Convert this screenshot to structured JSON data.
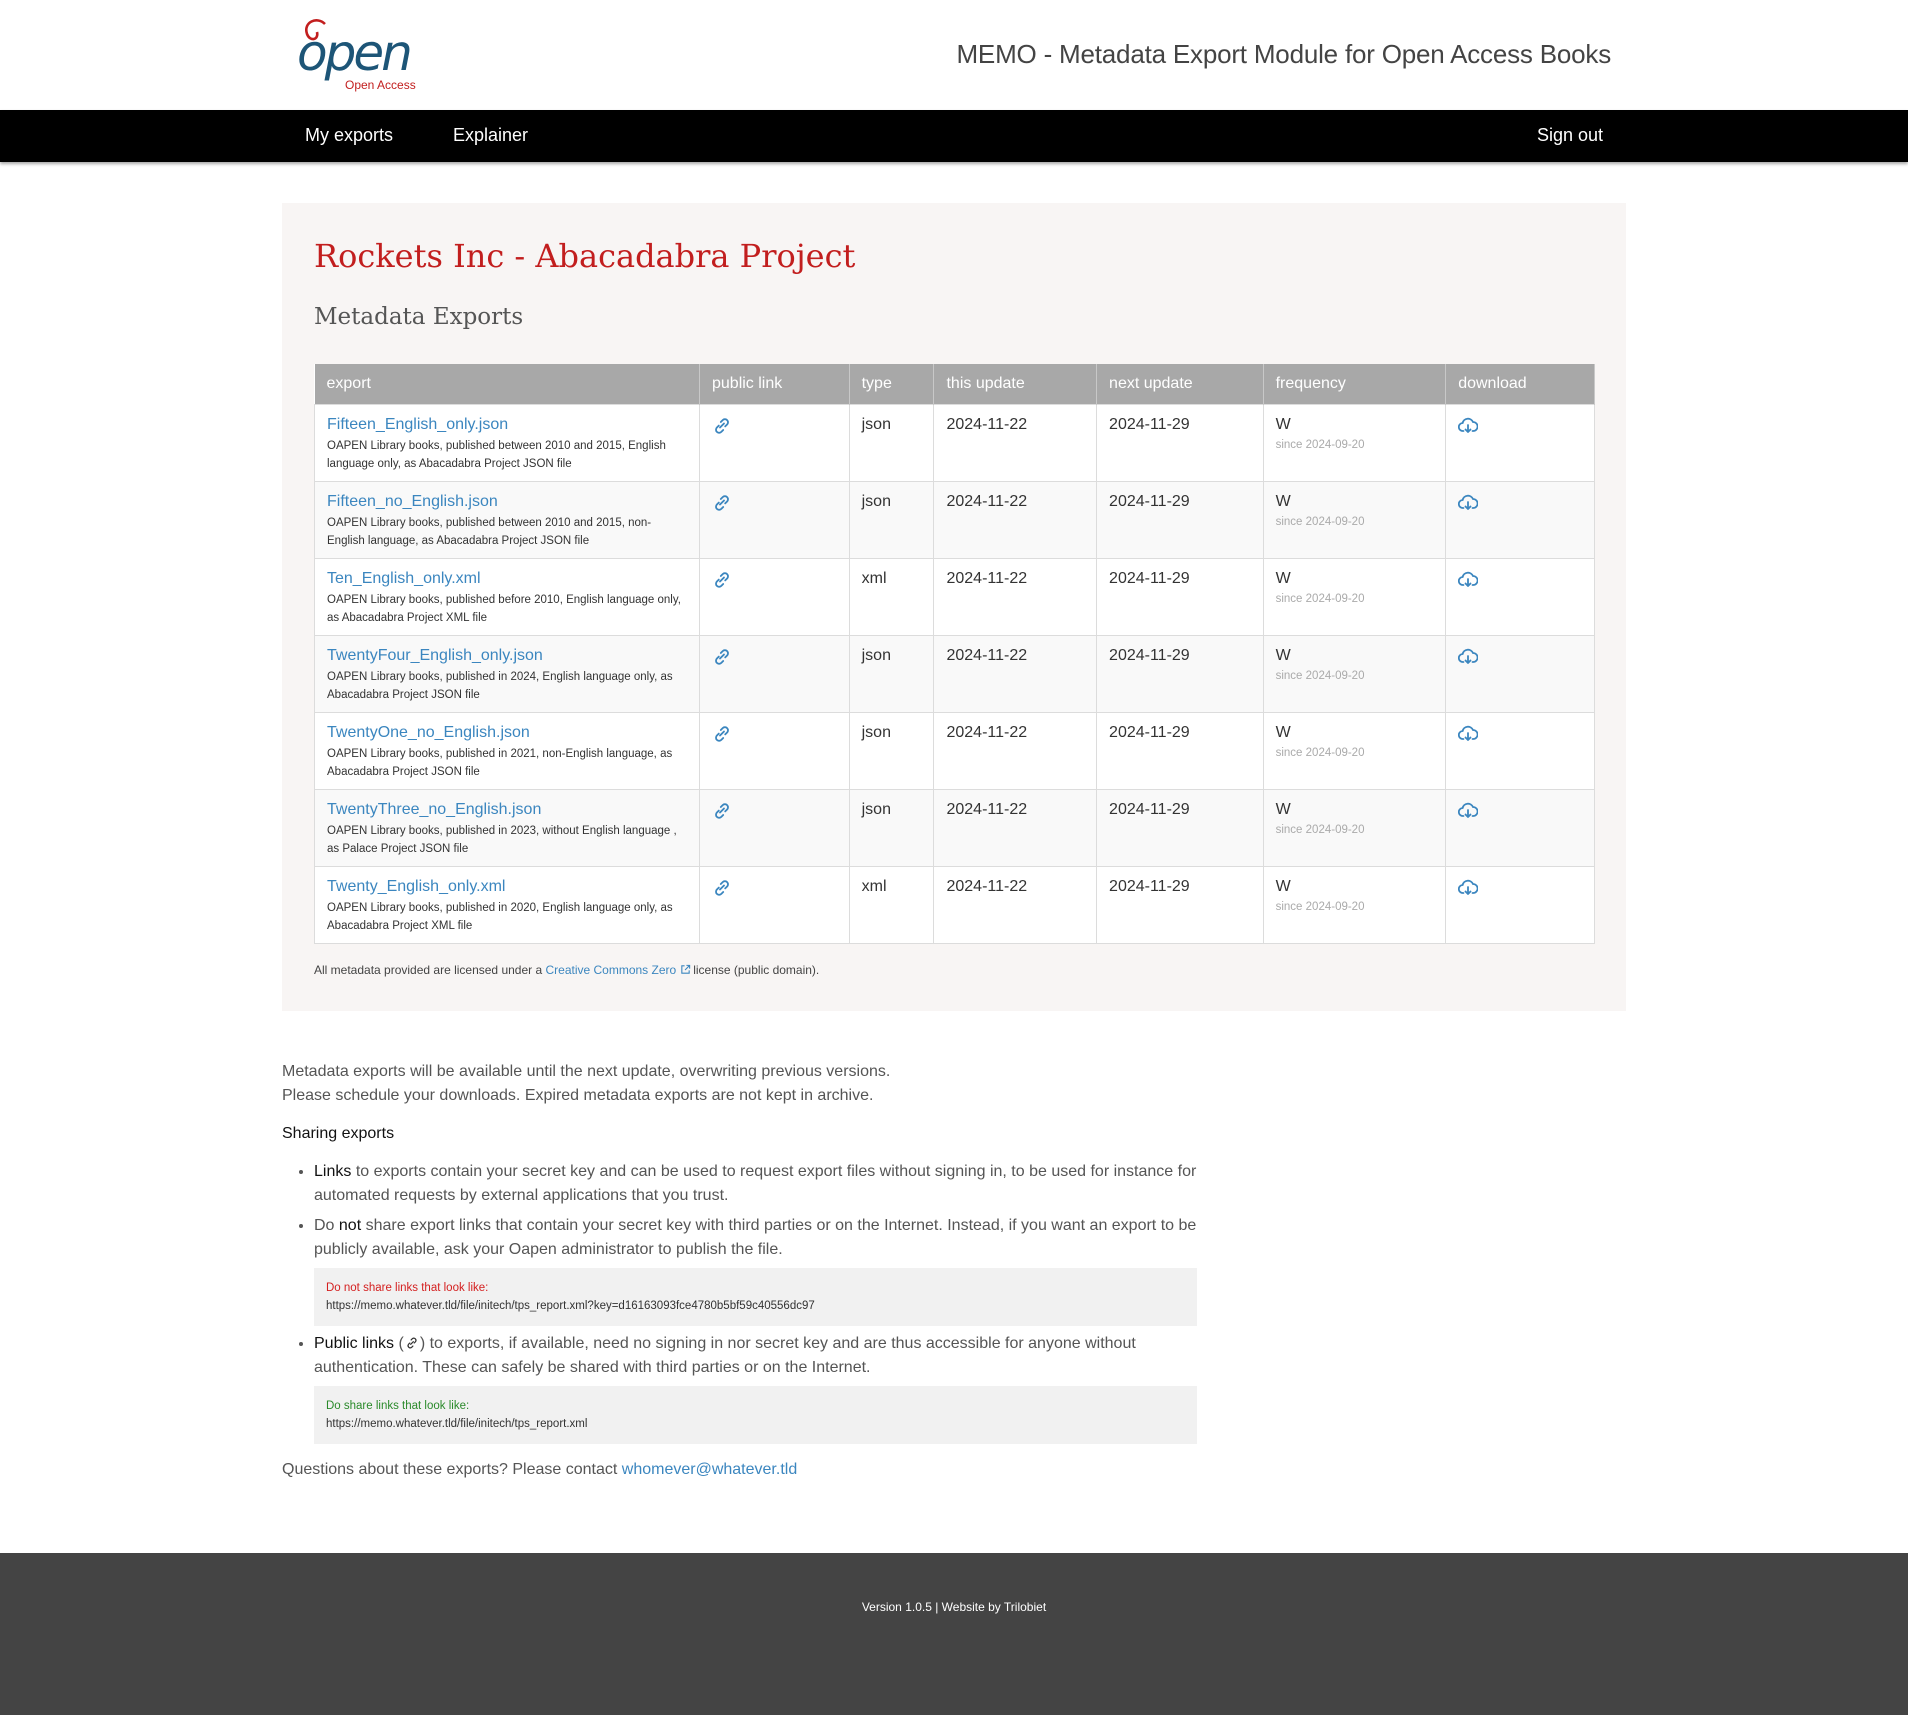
{
  "header": {
    "logo_text": "open",
    "logo_subtext": "Open Access",
    "site_title": "MEMO - Metadata Export Module for Open Access Books"
  },
  "nav": {
    "my_exports": "My exports",
    "explainer": "Explainer",
    "sign_out": "Sign out"
  },
  "panel": {
    "title": "Rockets Inc - Abacadabra Project",
    "subtitle": "Metadata Exports",
    "columns": [
      "export",
      "public link",
      "type",
      "this update",
      "next update",
      "frequency",
      "download"
    ],
    "rows": [
      {
        "name": "Fifteen_English_only.json",
        "desc": "OAPEN Library books, published between 2010 and 2015, English language only, as Abacadabra Project JSON file",
        "type": "json",
        "this_update": "2024-11-22",
        "next_update": "2024-11-29",
        "frequency": "W",
        "since": "since 2024-09-20"
      },
      {
        "name": "Fifteen_no_English.json",
        "desc": "OAPEN Library books, published between 2010 and 2015, non-English language, as Abacadabra Project JSON file",
        "type": "json",
        "this_update": "2024-11-22",
        "next_update": "2024-11-29",
        "frequency": "W",
        "since": "since 2024-09-20"
      },
      {
        "name": "Ten_English_only.xml",
        "desc": "OAPEN Library books, published before 2010, English language only, as Abacadabra Project XML file",
        "type": "xml",
        "this_update": "2024-11-22",
        "next_update": "2024-11-29",
        "frequency": "W",
        "since": "since 2024-09-20"
      },
      {
        "name": "TwentyFour_English_only.json",
        "desc": "OAPEN Library books, published in 2024, English language only, as Abacadabra Project JSON file",
        "type": "json",
        "this_update": "2024-11-22",
        "next_update": "2024-11-29",
        "frequency": "W",
        "since": "since 2024-09-20"
      },
      {
        "name": "TwentyOne_no_English.json",
        "desc": "OAPEN Library books, published in 2021, non-English language, as Abacadabra Project JSON file",
        "type": "json",
        "this_update": "2024-11-22",
        "next_update": "2024-11-29",
        "frequency": "W",
        "since": "since 2024-09-20"
      },
      {
        "name": "TwentyThree_no_English.json",
        "desc": "OAPEN Library books, published in 2023, without English language , as Palace Project JSON file",
        "type": "json",
        "this_update": "2024-11-22",
        "next_update": "2024-11-29",
        "frequency": "W",
        "since": "since 2024-09-20"
      },
      {
        "name": "Twenty_English_only.xml",
        "desc": "OAPEN Library books, published in 2020, English language only, as Abacadabra Project XML file",
        "type": "xml",
        "this_update": "2024-11-22",
        "next_update": "2024-11-29",
        "frequency": "W",
        "since": "since 2024-09-20"
      }
    ],
    "license_prefix": "All metadata provided are licensed under a",
    "license_link": "Creative Commons Zero",
    "license_suffix": "license (public domain)."
  },
  "info": {
    "line1": "Metadata exports will be available until the next update, overwriting previous versions.",
    "line2": "Please schedule your downloads. Expired metadata exports are not kept in archive.",
    "sharing_heading": "Sharing exports",
    "b1_strong": "Links",
    "b1_text": "to exports contain your secret key and can be used to request export files without signing in, to be used for instance for automated requests by external applications that you trust.",
    "b2_pre": "Do",
    "b2_strong": "not",
    "b2_text": "share export links that contain your secret key with third parties or on the Internet. Instead, if you want an export to be publicly available, ask your Oapen administrator to publish the file.",
    "warn_label": "Do not share links that look like:",
    "warn_url": "https://memo.whatever.tld/file/initech/tps_report.xml?key=d16163093fce4780b5bf59c40556dc97",
    "b3_strong": "Public links",
    "b3_text": ") to exports, if available, need no signing in nor secret key and are thus accessible for anyone without authentication. These can safely be shared with third parties or on the Internet.",
    "ok_label": "Do share links that look like:",
    "ok_url": "https://memo.whatever.tld/file/initech/tps_report.xml",
    "contact_text": "Questions about these exports? Please contact",
    "contact_email": "whomever@whatever.tld"
  },
  "footer": {
    "text": "Version 1.0.5 | Website by Trilobiet"
  },
  "colors": {
    "accent_red": "#c21e1e",
    "link_blue": "#3b86bf",
    "nav_bg": "#000000",
    "footer_bg": "#444444",
    "table_header": "#a8a8a8"
  }
}
